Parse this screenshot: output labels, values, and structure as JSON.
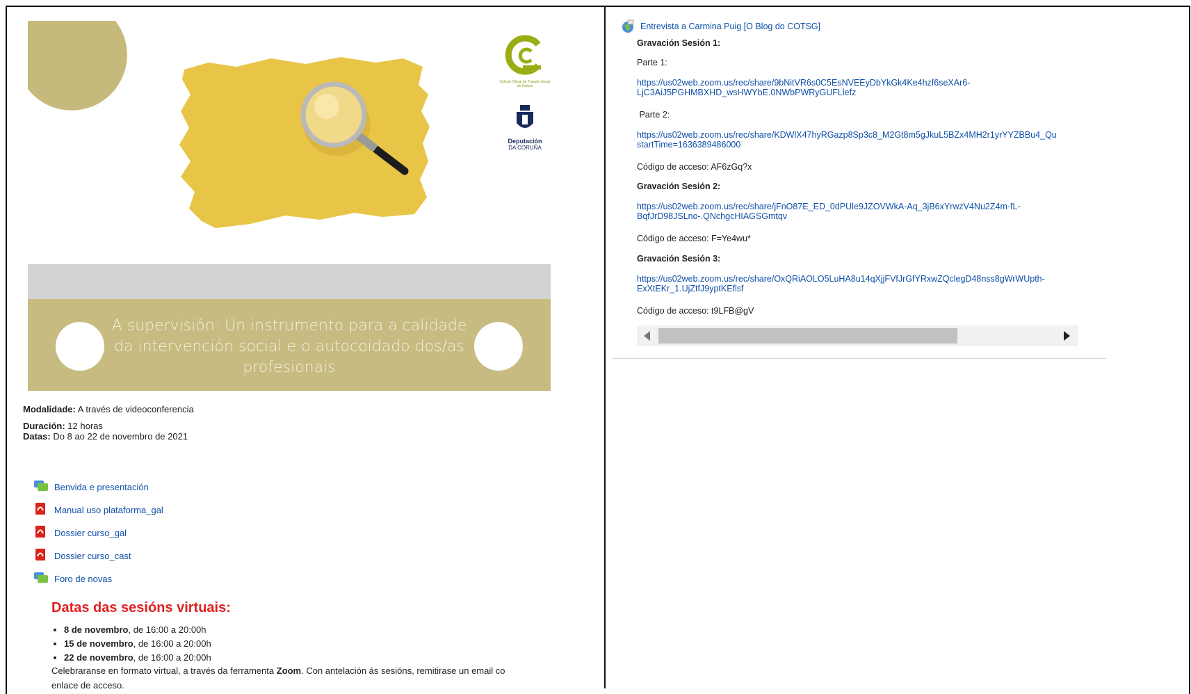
{
  "left": {
    "banner_title": "A supervisión: Un instrumento para a calidade da intervención social e o autocoidado dos/as profesionais",
    "logo_small_text": "Colexio Oficial de Traballo Social de Galicia",
    "logo_dep_title": "Deputación",
    "logo_dep_sub": "DA CORUÑA",
    "modalidade_label": "Modalidade:",
    "modalidade_value": "A través de videoconferencia",
    "duracion_label": "Duración:",
    "duracion_value": "12  horas",
    "datas_label": "Datas:",
    "datas_value": "Do 8 ao 22 de novembro de  2021",
    "resources": [
      {
        "label": "Benvida e presentación",
        "icon": "forum-icon"
      },
      {
        "label": "Manual uso plataforma_gal",
        "icon": "pdf-icon"
      },
      {
        "label": "Dossier curso_gal",
        "icon": "pdf-icon"
      },
      {
        "label": "Dossier curso_cast",
        "icon": "pdf-icon"
      },
      {
        "label": "Foro de novas",
        "icon": "forum-icon"
      }
    ],
    "sessions_title": "Datas das sesións virtuais:",
    "sessions": [
      {
        "date": "8 de novembro",
        "time": ", de 16:00 a 20:00h"
      },
      {
        "date": "15 de novembro",
        "time": ", de 16:00 a 20:00h"
      },
      {
        "date": "22 de novembro",
        "time": ", de 16:00 a 20:00h"
      }
    ],
    "note_pre": "Celebraranse en formato virtual, a través da ferramenta ",
    "note_bold": "Zoom",
    "note_post": ".  Con antelación ás sesións, remitirase un email co enlace de acceso."
  },
  "right": {
    "interview_link": "Entrevista a Carmina Puig [O Blog do COTSG]",
    "s1_title": "Gravación Sesión 1:",
    "parte1": "Parte 1:",
    "s1_link1_line1": "https://us02web.zoom.us/rec/share/9bNitVR6s0C5EsNVEEyDbYkGk4Ke4hzf6seXAr6-",
    "s1_link1_line2": "LjC3AiJ5PGHMBXHD_wsHWYbE.0NWbPWRyGUFLlefz",
    "parte2": " Parte 2:",
    "s1_link2_line1": "https://us02web.zoom.us/rec/share/KDWlX47hyRGazp8Sp3c8_M2Gt8m5gJkuL5BZx4MH2r1yrYYZBBu4_Qu",
    "s1_link2_line2": "startTime=1636389486000",
    "s1_code": "Código de acceso: AF6zGq?x",
    "s2_title": "Gravación Sesión 2:",
    "s2_link_line1": "https://us02web.zoom.us/rec/share/jFnO87E_ED_0dPUle9JZOVWkA-Aq_3jB6xYrwzV4Nu2Z4m-fL-",
    "s2_link_line2": "BqfJrD98JSLno-.QNchgcHIAGSGmtqv",
    "s2_code": "Código de acceso: F=Ye4wu*",
    "s3_title": "Gravación Sesión 3:",
    "s3_link_line1": "https://us02web.zoom.us/rec/share/OxQRiAOLO5LuHA8u14qXjjFVfJrGfYRxwZQclegD48nss8gWrWUpth-",
    "s3_link_line2": "ExXtEKr_1.UjZtfJ9yptKEflsf",
    "s3_code": "Código de acceso: t9LFB@gV",
    "scroll_position": 0.0
  },
  "colors": {
    "link": "#0e4fa8",
    "banner": "#c7bb82",
    "mustard": "#e8c547",
    "session_title": "#e02020"
  }
}
